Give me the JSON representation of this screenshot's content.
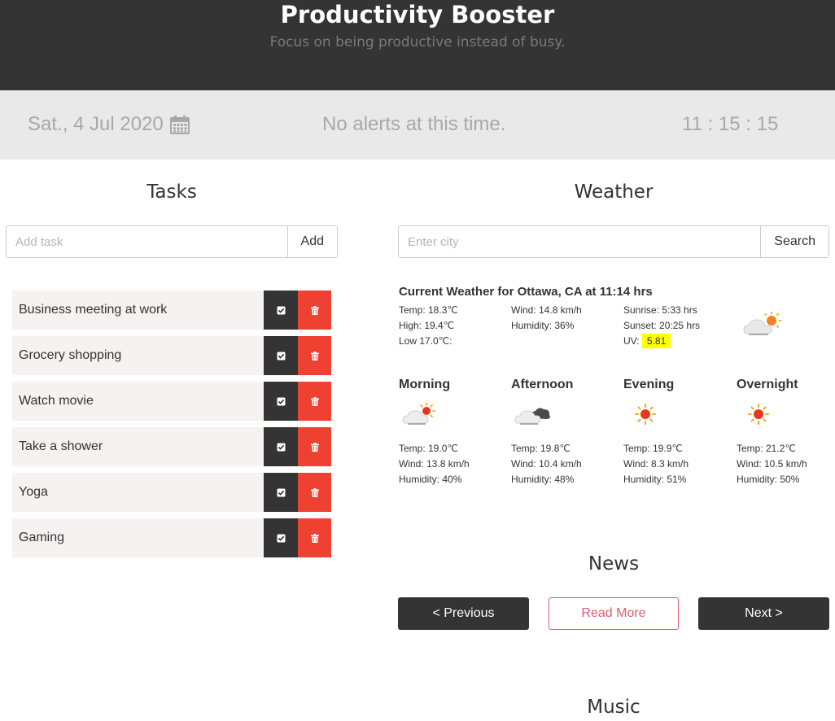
{
  "header": {
    "title": "Productivity Booster",
    "subtitle": "Focus on being productive instead of busy."
  },
  "infobar": {
    "date": "Sat., 4 Jul 2020",
    "alerts": "No alerts at this time.",
    "clock": "11 : 15 : 15"
  },
  "tasks": {
    "title": "Tasks",
    "input_placeholder": "Add task",
    "add_label": "Add",
    "items": [
      {
        "label": "Business meeting at work"
      },
      {
        "label": "Grocery shopping"
      },
      {
        "label": "Watch movie"
      },
      {
        "label": "Take a shower"
      },
      {
        "label": "Yoga"
      },
      {
        "label": "Gaming"
      }
    ]
  },
  "weather": {
    "title": "Weather",
    "input_placeholder": "Enter city",
    "search_label": "Search",
    "current": {
      "heading": "Current Weather for Ottawa, CA at 11:14 hrs",
      "temp": "Temp:  18.3℃",
      "high": "High:  19.4℃",
      "low": "Low  17.0℃:",
      "wind": "Wind:  14.8 km/h",
      "humidity": "Humidity:  36%",
      "sunrise": "Sunrise:  5:33 hrs",
      "sunset": "Sunset:  20:25 hrs",
      "uv_label": "UV:",
      "uv_value": "5.81",
      "icon": "partly-cloudy-icon"
    },
    "periods": [
      {
        "name": "Morning",
        "icon": "partly-cloudy-icon",
        "temp": "Temp:   19.0℃",
        "wind": "Wind:   13.8 km/h",
        "humidity": "Humidity:   40%"
      },
      {
        "name": "Afternoon",
        "icon": "cloudy-icon",
        "temp": "Temp:   19.8℃",
        "wind": "Wind:   10.4 km/h",
        "humidity": "Humidity:   48%"
      },
      {
        "name": "Evening",
        "icon": "sun-icon",
        "temp": "Temp:   19.9℃",
        "wind": "Wind:   8.3 km/h",
        "humidity": "Humidity:   51%"
      },
      {
        "name": "Overnight",
        "icon": "sun-icon",
        "temp": "Temp:   21.2℃",
        "wind": "Wind:   10.5 km/h",
        "humidity": "Humidity:   50%"
      }
    ]
  },
  "news": {
    "title": "News",
    "previous_label": "< Previous",
    "read_more_label": "Read More",
    "next_label": "Next >"
  },
  "music": {
    "title": "Music"
  },
  "colors": {
    "header_bg": "#343434",
    "delete_red": "#ee4131",
    "uv_highlight": "#ffff00",
    "read_more_accent": "#e05a6c"
  }
}
